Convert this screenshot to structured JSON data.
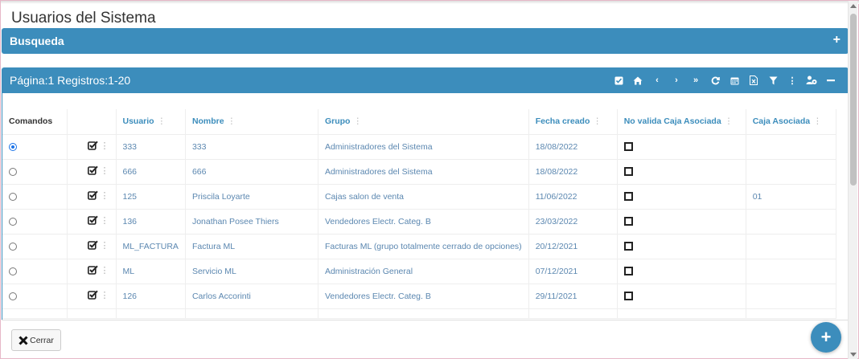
{
  "page_title": "Usuarios del Sistema",
  "search_panel": {
    "title": "Busqueda",
    "expand_icon": "plus-icon"
  },
  "grid_panel": {
    "title": "Página:1 Registros:1-20",
    "toolbar_icons": [
      "check-square-icon",
      "home-icon",
      "chevron-left-icon",
      "chevron-right-icon",
      "double-chevron-right-icon",
      "refresh-icon",
      "calendar-icon",
      "excel-icon",
      "filter-icon",
      "vertical-dots-icon",
      "users-cog-icon",
      "minus-icon"
    ]
  },
  "table": {
    "columns": [
      "Comandos",
      "",
      "Usuario",
      "Nombre",
      "Grupo",
      "Fecha creado",
      "No valida Caja Asociada",
      "Caja Asociada"
    ],
    "rows": [
      {
        "usuario": "333",
        "nombre": "333",
        "grupo": "Administradores del Sistema",
        "fecha": "18/08/2022",
        "caja": "",
        "selected": true
      },
      {
        "usuario": "666",
        "nombre": "666",
        "grupo": "Administradores del Sistema",
        "fecha": "18/08/2022",
        "caja": "",
        "selected": false
      },
      {
        "usuario": "125",
        "nombre": "Priscila Loyarte",
        "grupo": "Cajas salon de venta",
        "fecha": "11/06/2022",
        "caja": "01",
        "selected": false
      },
      {
        "usuario": "136",
        "nombre": "Jonathan Posee Thiers",
        "grupo": "Vendedores Electr. Categ. B",
        "fecha": "23/03/2022",
        "caja": "",
        "selected": false
      },
      {
        "usuario": "ML_FACTURA",
        "nombre": "Factura ML",
        "grupo": "Facturas ML (grupo totalmente cerrado de opciones)",
        "fecha": "20/12/2021",
        "caja": "",
        "selected": false
      },
      {
        "usuario": "ML",
        "nombre": "Servicio ML",
        "grupo": "Administración General",
        "fecha": "07/12/2021",
        "caja": "",
        "selected": false
      },
      {
        "usuario": "126",
        "nombre": "Carlos Accorinti",
        "grupo": "Vendedores Electr. Categ. B",
        "fecha": "29/11/2021",
        "caja": "",
        "selected": false
      }
    ]
  },
  "footer": {
    "close_label": "Cerrar"
  },
  "colors": {
    "primary": "#3c8dbc",
    "link": "#5b87b0"
  }
}
